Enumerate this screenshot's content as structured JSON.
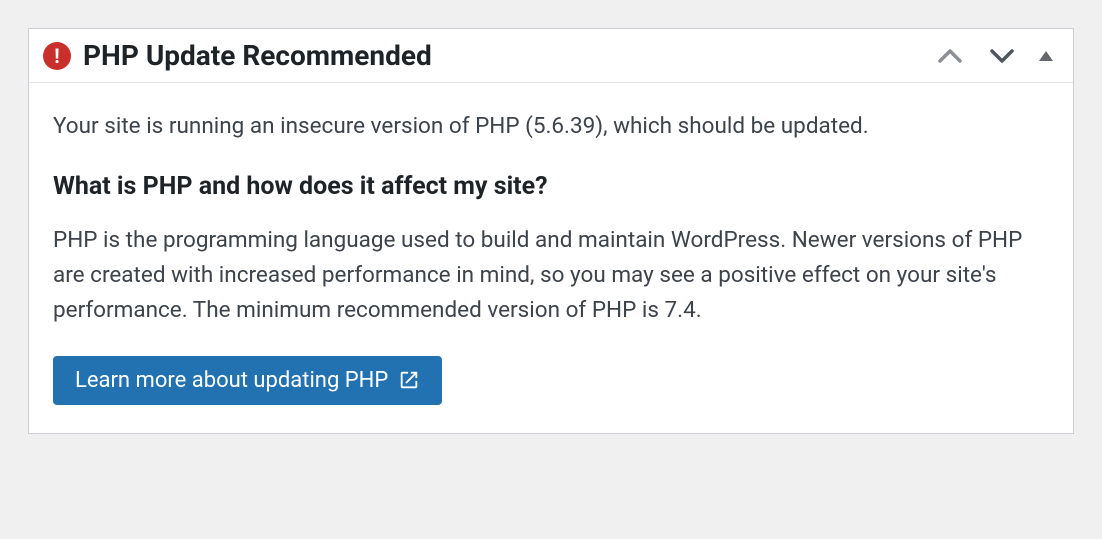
{
  "panel": {
    "title": "PHP Update Recommended",
    "icon": "warning",
    "body": {
      "intro": "Your site is running an insecure version of PHP (5.6.39), which should be updated.",
      "heading": "What is PHP and how does it affect my site?",
      "paragraph": "PHP is the programming language used to build and maintain WordPress. Newer versions of PHP are created with increased performance in mind, so you may see a positive effect on your site's performance. The minimum recommended version of PHP is 7.4."
    },
    "action": {
      "label": "Learn more about updating PHP"
    }
  }
}
